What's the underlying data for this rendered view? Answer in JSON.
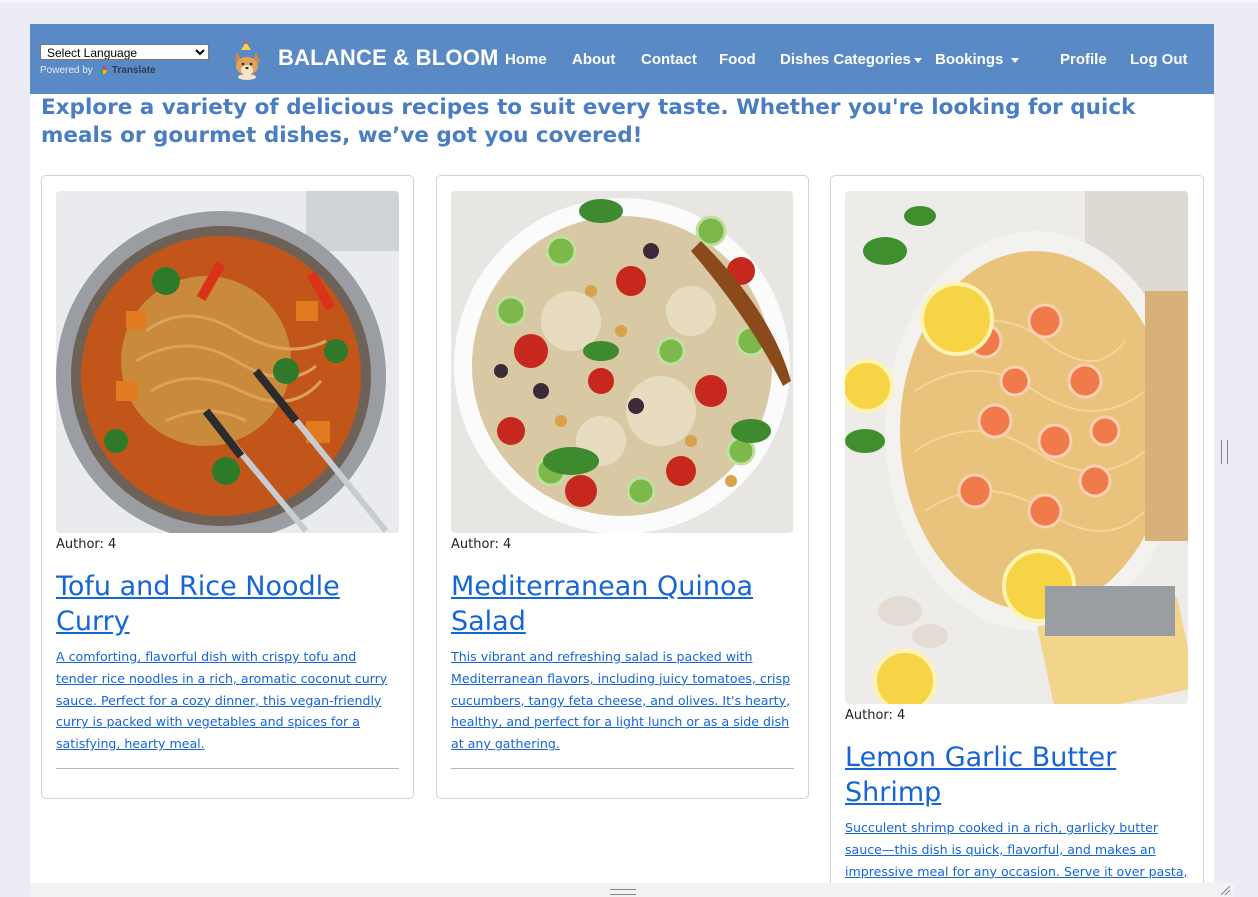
{
  "translate": {
    "select_label": "Select Language",
    "powered_by": "Powered by",
    "translate_label": "Translate"
  },
  "brand": {
    "name": "BALANCE & BLOOM",
    "logo_icon": "corgi-logo-icon"
  },
  "nav": {
    "home": "Home",
    "about": "About",
    "contact": "Contact",
    "food": "Food",
    "dishes_categories": "Dishes Categories",
    "bookings": "Bookings",
    "profile": "Profile",
    "logout": "Log Out"
  },
  "intro": "Explore a variety of delicious recipes to suit every taste. Whether you're looking for quick meals or gourmet dishes, we’ve got you covered!",
  "recipes": [
    {
      "author": "Author: 4",
      "title": "Tofu and Rice Noodle Curry",
      "description": "A comforting, flavorful dish with crispy tofu and tender rice noodles in a rich, aromatic coconut curry sauce. Perfect for a cozy dinner, this vegan-friendly curry is packed with vegetables and spices for a satisfying, hearty meal.",
      "image": "noodle-curry-photo"
    },
    {
      "author": "Author: 4",
      "title": "Mediterranean Quinoa Salad",
      "description": "This vibrant and refreshing salad is packed with Mediterranean flavors, including juicy tomatoes, crisp cucumbers, tangy feta cheese, and olives. It's hearty, healthy, and perfect for a light lunch or as a side dish at any gathering.",
      "image": "quinoa-salad-photo"
    },
    {
      "author": "Author: 4",
      "title": "Lemon Garlic Butter Shrimp",
      "description": "Succulent shrimp cooked in a rich, garlicky butter sauce—this dish is quick, flavorful, and makes an impressive meal for any occasion. Serve it over pasta,",
      "image": "shrimp-pasta-photo"
    }
  ],
  "colors": {
    "navbar": "#5a8ac6",
    "link": "#1565d8",
    "intro": "#4a7dc1"
  }
}
